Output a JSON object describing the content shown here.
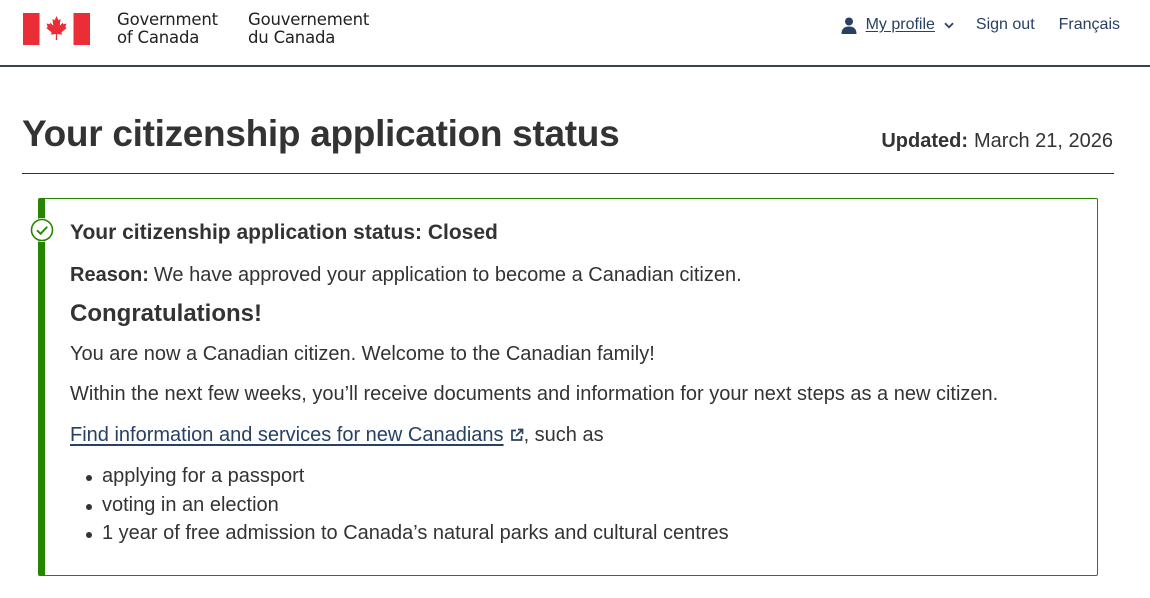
{
  "header": {
    "signature_en": [
      "Government",
      "of Canada"
    ],
    "signature_fr": [
      "Gouvernement",
      "du Canada"
    ],
    "flag_icon": "canada-flag-icon",
    "nav": {
      "profile_label": "My profile",
      "signout_label": "Sign out",
      "language_label": "Français"
    }
  },
  "page": {
    "title": "Your citizenship application status",
    "updated_label": "Updated:",
    "updated_value": "March 21, 2026"
  },
  "status_panel": {
    "icon": "check-circle-icon",
    "heading": "Your citizenship application status: Closed",
    "reason_label": "Reason:",
    "reason_text": "We have approved your application to become a Canadian citizen.",
    "congrats_heading": "Congratulations!",
    "paragraph_1": "You are now a Canadian citizen. Welcome to the Canadian family!",
    "paragraph_2": "Within the next few weeks, you’ll receive documents and information for your next steps as a new citizen.",
    "link_text": "Find information and services for new Canadians",
    "link_suffix": ", such as",
    "benefits": [
      "applying for a passport",
      "voting in an election",
      "1 year of free admission to Canada’s natural parks and cultural centres"
    ]
  },
  "colors": {
    "accent_green": "#278400",
    "link_blue": "#284162",
    "flag_red": "#eb2d37",
    "header_rule": "#38414d"
  }
}
